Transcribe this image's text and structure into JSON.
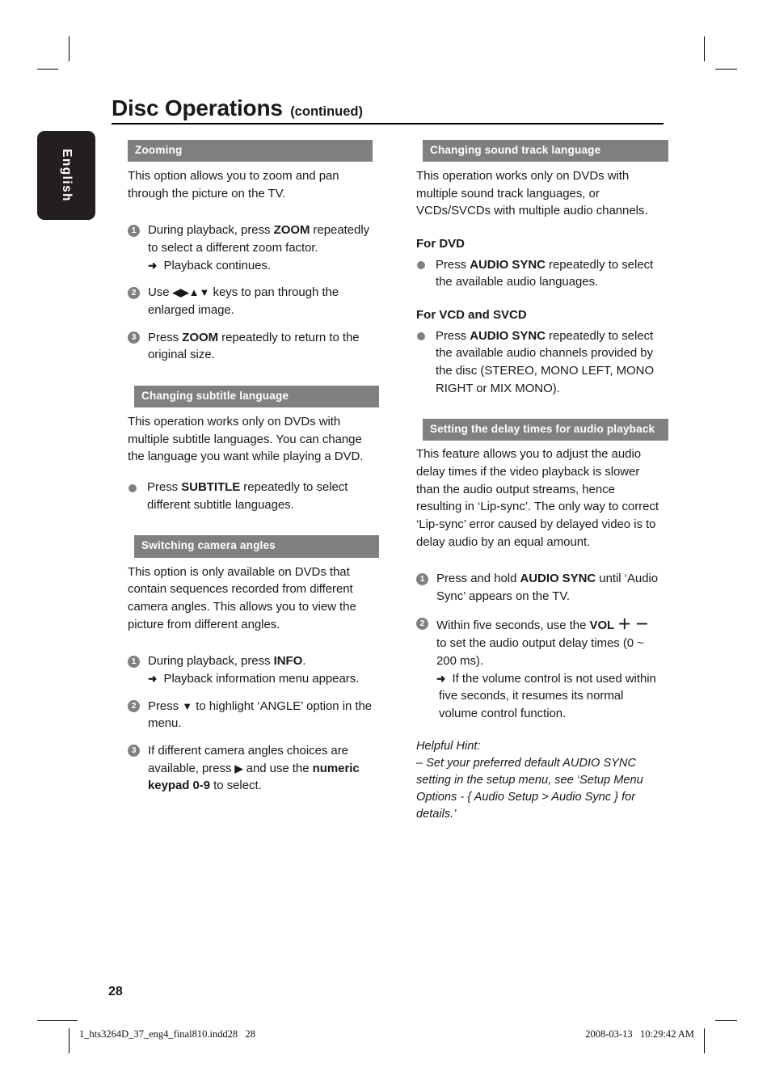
{
  "sidebar": {
    "language_tab": "English"
  },
  "header": {
    "title": "Disc Operations",
    "title_suffix": "(continued)"
  },
  "left_column": {
    "zooming": {
      "heading": "Zooming",
      "intro": "This option allows you to zoom and pan through the picture on the TV.",
      "steps": [
        {
          "number": "1",
          "text_before": "During playback, press ",
          "bold": "ZOOM",
          "text_after": " repeatedly to select a different zoom factor.",
          "arrow_note": "Playback continues."
        },
        {
          "number": "2",
          "text_before": "Use ",
          "keys": "◀▶▲▼",
          "text_after": " keys to pan through the enlarged image."
        },
        {
          "number": "3",
          "text_before": "Press ",
          "bold": "ZOOM",
          "text_after": " repeatedly to return to the original size."
        }
      ]
    },
    "subtitle_language": {
      "heading": "Changing subtitle language",
      "intro": "This operation works only on DVDs with multiple subtitle languages. You can change the language you want while playing a DVD.",
      "bullet": {
        "text_before": "Press ",
        "bold": "SUBTITLE",
        "text_after": " repeatedly to select different subtitle languages."
      }
    },
    "camera_angles": {
      "heading": "Switching camera angles",
      "intro": "This option is only available on DVDs that contain sequences recorded from different camera angles. This allows you to view the picture from different angles.",
      "steps": [
        {
          "number": "1",
          "text_before": "During playback, press ",
          "bold": "INFO",
          "text_after": ".",
          "arrow_note": "Playback information menu appears."
        },
        {
          "number": "2",
          "text_before": "Press ",
          "key": "▼",
          "text_after": " to highlight ‘ANGLE’ option in the menu."
        },
        {
          "number": "3",
          "text_before": "If different camera angles choices are available, press ",
          "key": "▶",
          "text_mid": " and use the ",
          "bold": "numeric keypad 0-9",
          "text_after": " to select."
        }
      ]
    }
  },
  "right_column": {
    "sound_track": {
      "heading": "Changing sound track language",
      "intro": "This operation works only on DVDs with multiple sound track languages, or VCDs/SVCDs with multiple audio channels.",
      "for_dvd": {
        "subhead": "For DVD",
        "bullet": {
          "text_before": "Press ",
          "bold": "AUDIO SYNC",
          "text_after": " repeatedly to select the available audio languages."
        }
      },
      "for_vcd": {
        "subhead": "For VCD and SVCD",
        "bullet": {
          "text_before": "Press ",
          "bold": "AUDIO SYNC",
          "text_after": " repeatedly to select the available audio channels provided by the disc (STEREO, MONO LEFT, MONO RIGHT or MIX MONO)."
        }
      }
    },
    "audio_delay": {
      "heading": "Setting the delay times for audio playback",
      "intro": "This feature allows you to adjust the audio delay times if the video playback is slower than the audio output streams, hence resulting in ‘Lip-sync’. The only way to correct ‘Lip-sync’ error caused by delayed video is to delay audio by an equal amount.",
      "steps": [
        {
          "number": "1",
          "text_before": "Press and hold ",
          "bold": "AUDIO SYNC",
          "text_after": " until ‘Audio Sync’ appears on the TV."
        },
        {
          "number": "2",
          "text_before": "Within five seconds, use the ",
          "bold": "VOL",
          "symbols": "＋ －",
          "text_after": " to set the audio output delay times (0 ~ 200 ms).",
          "arrow_note": "If the volume control is not used within five seconds, it resumes its normal volume control function."
        }
      ],
      "hint": {
        "label": "Helpful Hint:",
        "text": "–  Set your preferred default AUDIO SYNC setting in the setup menu, see ‘Setup Menu Options - { Audio Setup > Audio Sync } for details.’"
      }
    }
  },
  "footer": {
    "page_number": "28",
    "file_name": "1_hts3264D_37_eng4_final810.indd28   28",
    "timestamp": "2008-03-13   10:29:42 AM"
  },
  "colors": {
    "heading_bar": "#808080",
    "badge": "#808080",
    "tab_background": "#231f20",
    "text": "#1a1a1a"
  }
}
